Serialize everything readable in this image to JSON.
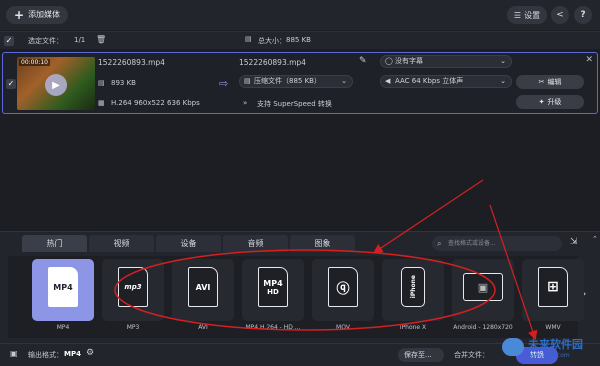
{
  "topbar": {
    "add_media_label": "添加媒体",
    "settings_label": "设置",
    "help_label": "?"
  },
  "selection": {
    "selected_files_label": "选定文件：",
    "selected_files_value": "1/1",
    "total_size_label": "总大小：",
    "total_size_value": "885 KB"
  },
  "file": {
    "thumb_time": "00:00:10",
    "source_name": "1522260893.mp4",
    "source_size": "893 KB",
    "source_codec": "H.264 960x522 636 Kbps",
    "output_name": "1522260893.mp4",
    "compression": "压缩文件（885 KB）",
    "superspeed": "支持 SuperSpeed 转换",
    "subtitle": "没有字幕",
    "audio": "AAC 64 Kbps 立体声",
    "edit_label": "编辑",
    "upgrade_label": "升级"
  },
  "tabs": [
    {
      "label": "热门"
    },
    {
      "label": "视频"
    },
    {
      "label": "设备"
    },
    {
      "label": "音频"
    },
    {
      "label": "图象"
    }
  ],
  "format_search_placeholder": "查找格式或设备...",
  "formats": [
    {
      "badge": "MP4",
      "sub": "",
      "label": "MP4"
    },
    {
      "badge": "mp3",
      "sub": "",
      "label": "MP3"
    },
    {
      "badge": "AVI",
      "sub": "",
      "label": "AVI"
    },
    {
      "badge": "MP4",
      "sub": "HD",
      "label": "MP4 H.264 - HD ..."
    },
    {
      "badge": "",
      "sub": "",
      "label": "MOV"
    },
    {
      "badge": "iPhone",
      "sub": "",
      "label": "iPhone X"
    },
    {
      "badge": "",
      "sub": "",
      "label": "Android - 1280x720"
    },
    {
      "badge": "",
      "sub": "",
      "label": "WMV"
    }
  ],
  "bottom": {
    "output_format_label": "输出格式：",
    "output_format_value": "MP4",
    "save_to_label": "保存至...",
    "merge_label": "合并文件：",
    "convert_label": "转换"
  },
  "watermark": {
    "text": "未来软件园",
    "sub": "www.pc6.com"
  },
  "colors": {
    "accent": "#5a6bd8",
    "annotation": "#d42020"
  }
}
